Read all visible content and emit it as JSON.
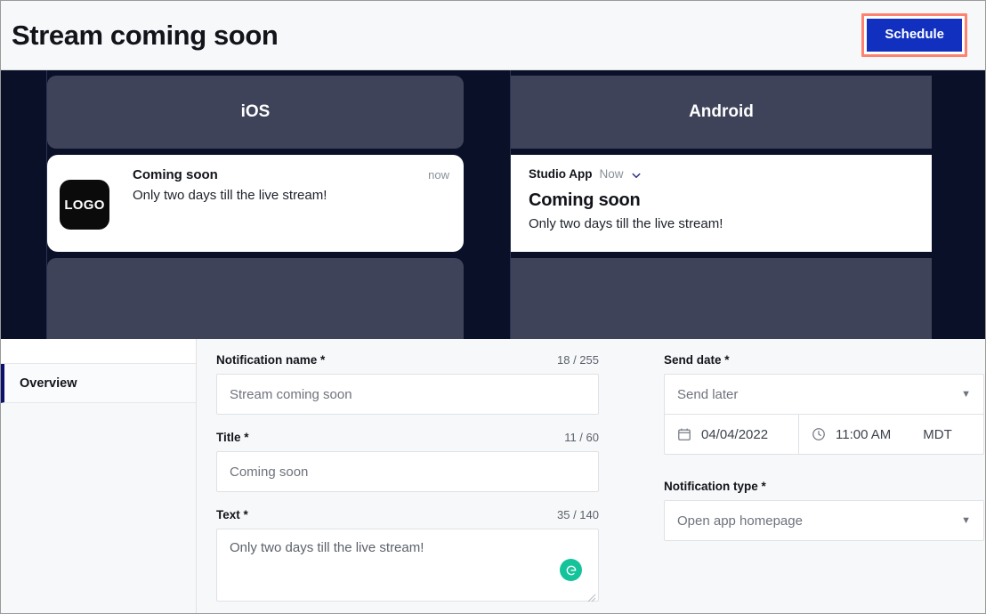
{
  "header": {
    "title": "Stream coming soon",
    "schedule_label": "Schedule",
    "accent_blue": "#1230c0",
    "highlight_red": "#fd8272"
  },
  "preview": {
    "ios": {
      "os_label": "iOS",
      "logo_text": "LOGO",
      "title": "Coming soon",
      "time": "now",
      "text": "Only two days till the live stream!"
    },
    "android": {
      "os_label": "Android",
      "app_name": "Studio App",
      "time": "Now",
      "chevron_icon": "chevron-down-icon",
      "title": "Coming soon",
      "text": "Only two days till the live stream!"
    },
    "colors": {
      "phone_background": "#0a1028",
      "panel": "#3e4359",
      "card": "#ffffff"
    }
  },
  "sidebar": {
    "items": [
      {
        "label": "Overview",
        "active": true
      }
    ]
  },
  "form": {
    "left": [
      {
        "label": "Notification name *",
        "counter": "18 / 255",
        "value": "Stream coming soon",
        "kind": "input"
      },
      {
        "label": "Title *",
        "counter": "11 / 60",
        "value": "Coming soon",
        "kind": "input"
      },
      {
        "label": "Text *",
        "counter": "35 / 140",
        "value": "Only two days till the live stream!",
        "kind": "textarea",
        "assistant_icon": "grammarly-icon"
      }
    ],
    "send_date": {
      "label": "Send date *",
      "mode_value": "Send later",
      "date_value": "04/04/2022",
      "date_icon": "calendar-icon",
      "time_value": "11:00 AM",
      "time_icon": "clock-icon",
      "timezone": "MDT"
    },
    "notification_type": {
      "label": "Notification type *",
      "value": "Open app homepage"
    }
  }
}
